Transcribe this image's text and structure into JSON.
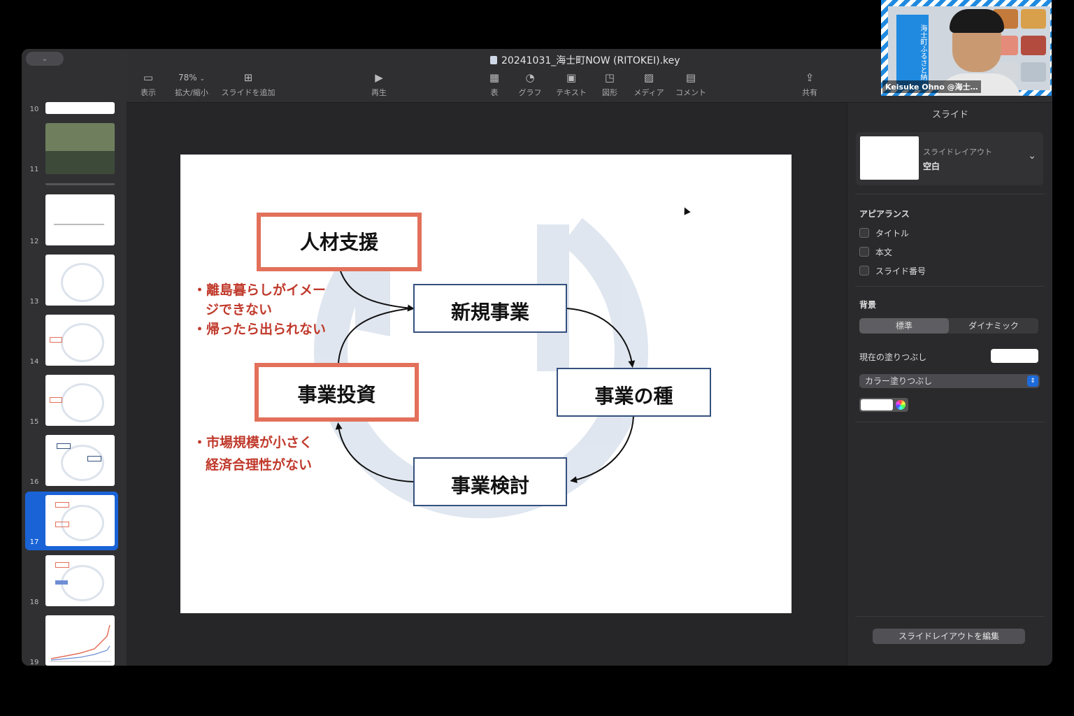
{
  "window": {
    "document_title": "20241031_海士町NOW (RITOKEI).key"
  },
  "toolbar": {
    "view_label": "表示",
    "zoom_value": "78%",
    "zoom_label": "拡大/縮小",
    "add_slide_label": "スライドを追加",
    "play_label": "再生",
    "table_label": "表",
    "chart_label": "グラフ",
    "text_label": "テキスト",
    "shape_label": "図形",
    "media_label": "メディア",
    "comment_label": "コメント",
    "share_label": "共有"
  },
  "slide_navigator": {
    "selected_slide": "17",
    "slides": [
      {
        "number": "10"
      },
      {
        "number": "11"
      },
      {
        "number": "12"
      },
      {
        "number": "13"
      },
      {
        "number": "14"
      },
      {
        "number": "15"
      },
      {
        "number": "16"
      },
      {
        "number": "17"
      },
      {
        "number": "18"
      },
      {
        "number": "19"
      }
    ]
  },
  "slide": {
    "box_jinzai": "人材支援",
    "box_shinki": "新規事業",
    "box_tane": "事業の種",
    "box_kentou": "事業検討",
    "box_toushi": "事業投資",
    "note_top_line1": "・離島暮らしがイメー",
    "note_top_line2": "ジできない",
    "note_top_line3": "・帰ったら出られない",
    "note_bottom_line1": "・市場規模が小さく",
    "note_bottom_line2": "経済合理性がない"
  },
  "inspector": {
    "title": "スライド",
    "layout_label": "スライドレイアウト",
    "layout_value": "空白",
    "appearance_heading": "アピアランス",
    "check_title": "タイトル",
    "check_body": "本文",
    "check_slide_number": "スライド番号",
    "background_heading": "背景",
    "seg_standard": "標準",
    "seg_dynamic": "ダイナミック",
    "current_fill_label": "現在の塗りつぶし",
    "fill_type": "カラー塗りつぶし",
    "edit_layout_button": "スライドレイアウトを編集"
  },
  "webcam": {
    "participant_name": "Keisuke Ohno @海士…",
    "banner_text": "海士町ふるさと納"
  },
  "colors": {
    "accent_red": "#e2705a",
    "note_red": "#c0392b",
    "box_blue": "#34507e",
    "selection_blue": "#1a63d6"
  }
}
